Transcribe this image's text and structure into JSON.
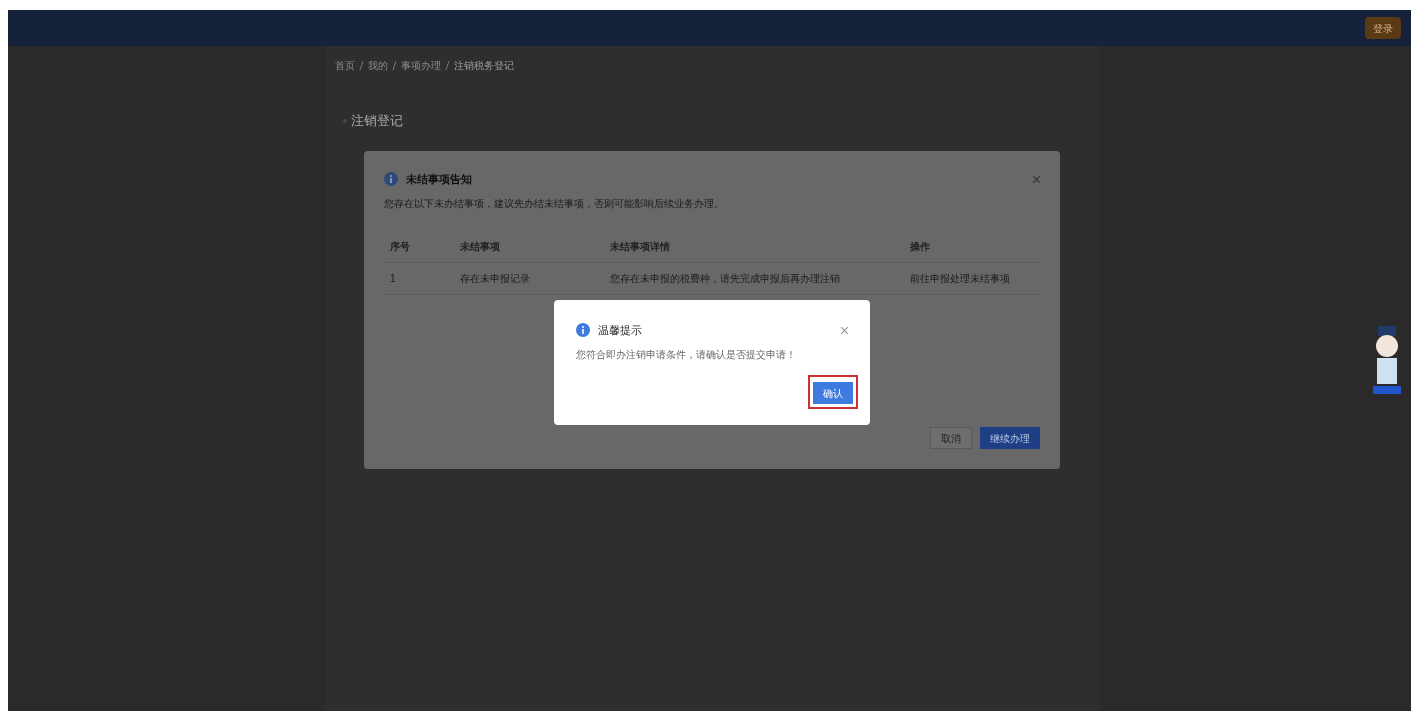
{
  "top_bar": {
    "action_button": "登录"
  },
  "breadcrumb": [
    "首页",
    "我的",
    "事项办理",
    "注销税务登记"
  ],
  "section_title": "注销登记",
  "notice_dialog": {
    "title": "未结事项告知",
    "description": "您存在以下未办结事项，建议先办结未结事项，否则可能影响后续业务办理。",
    "table": {
      "columns": [
        "序号",
        "未结事项",
        "未结事项详情",
        "操作"
      ],
      "rows": [
        [
          "1",
          "存在未申报记录",
          "您存在未申报的税费种，请先完成申报后再办理注销",
          "前往申报处理未结事项"
        ]
      ]
    },
    "buttons": [
      "取消",
      "继续办理"
    ]
  },
  "prompt_dialog": {
    "title": "温馨提示",
    "message": "您符合即办注销申请条件，请确认是否提交申请！",
    "button": "确认"
  }
}
